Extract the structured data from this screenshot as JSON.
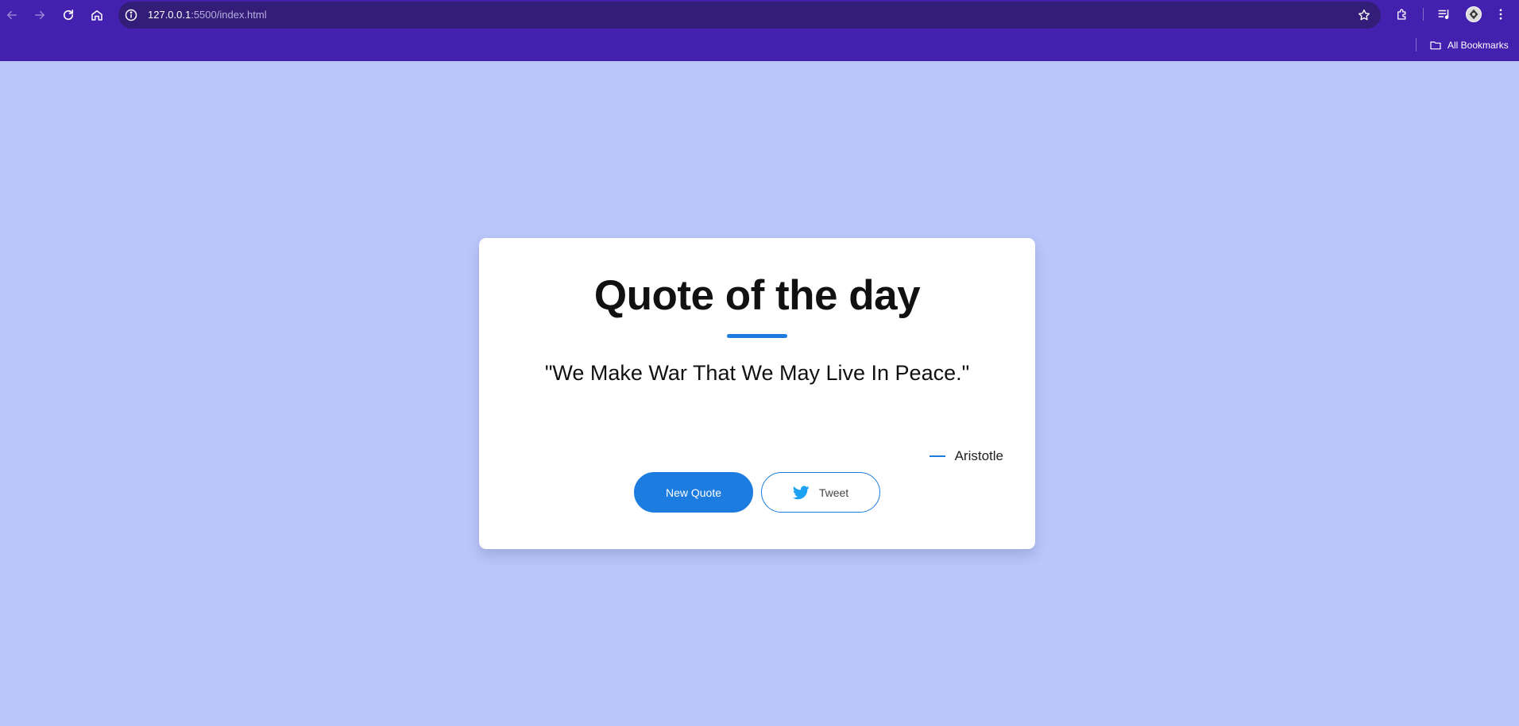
{
  "browser": {
    "url_host": "127.0.0.1",
    "url_path": ":5500/index.html",
    "bookmarks_label": "All Bookmarks",
    "icons": [
      "back-icon",
      "forward-icon",
      "reload-icon",
      "home-icon",
      "site-info-icon",
      "star-icon",
      "extensions-icon",
      "media-controls-icon",
      "avatar",
      "more-icon",
      "folder-icon"
    ]
  },
  "colors": {
    "browser_frame": "#4320ae",
    "omnibox": "#321d78",
    "page_background": "#bac6f9",
    "accent": "#1c7ce0",
    "twitter": "#1da1f2"
  },
  "card": {
    "title": "Quote of the day",
    "quote": "\"We Make War That We May Live In Peace.\"",
    "author": "Aristotle",
    "new_quote_label": "New Quote",
    "tweet_label": "Tweet"
  }
}
